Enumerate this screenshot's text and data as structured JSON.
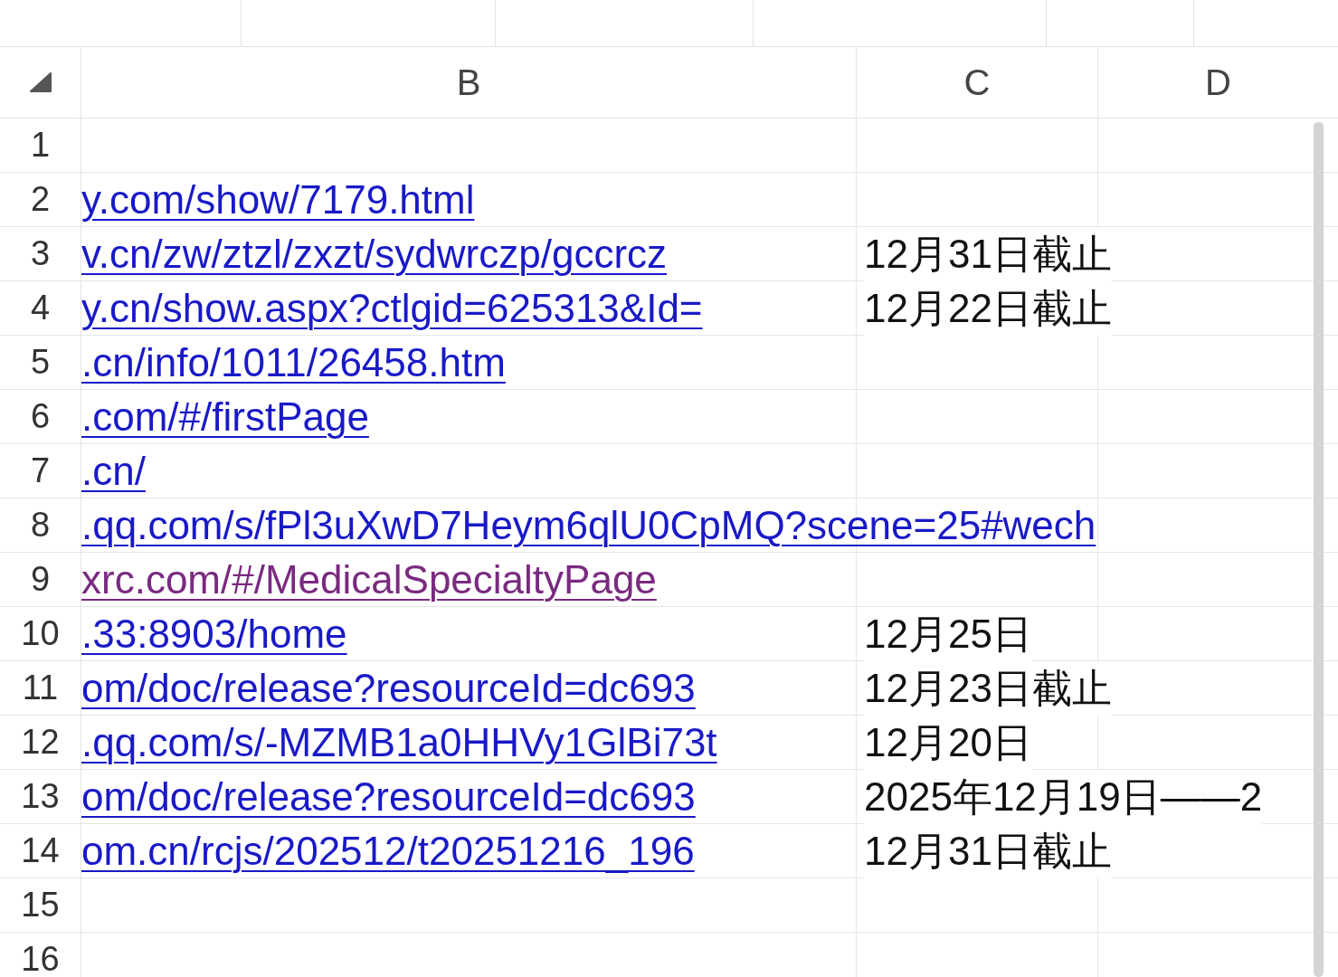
{
  "columns": [
    "B",
    "C",
    "D"
  ],
  "rows": [
    {
      "number": "1"
    },
    {
      "number": "2",
      "link": "y.com/show/7179.html",
      "visited": false
    },
    {
      "number": "3",
      "link": "v.cn/zw/ztzl/zxzt/sydwrczp/gccrcz",
      "visited": false,
      "column_c": "12月31日截止"
    },
    {
      "number": "4",
      "link": "y.cn/show.aspx?ctlgid=625313&Id=",
      "visited": false,
      "column_c": "12月22日截止"
    },
    {
      "number": "5",
      "link": ".cn/info/1011/26458.htm",
      "visited": false
    },
    {
      "number": "6",
      "link": ".com/#/firstPage",
      "visited": false
    },
    {
      "number": "7",
      "link": ".cn/",
      "visited": false
    },
    {
      "number": "8",
      "link": ".qq.com/s/fPl3uXwD7Heym6qlU0CpMQ?scene=25#wech",
      "visited": false
    },
    {
      "number": "9",
      "link": "xrc.com/#/MedicalSpecialtyPage",
      "visited": true
    },
    {
      "number": "10",
      "link": ".33:8903/home",
      "visited": false,
      "column_c": "12月25日"
    },
    {
      "number": "11",
      "link": "om/doc/release?resourceId=dc693",
      "visited": false,
      "column_c": "12月23日截止"
    },
    {
      "number": "12",
      "link": ".qq.com/s/-MZMB1a0HHVy1GlBi73t",
      "visited": false,
      "column_c": "12月20日"
    },
    {
      "number": "13",
      "link": "om/doc/release?resourceId=dc693",
      "visited": false,
      "column_c": "2025年12月19日——2"
    },
    {
      "number": "14",
      "link": "om.cn/rcjs/202512/t20251216_196",
      "visited": false,
      "column_c": "12月31日截止"
    },
    {
      "number": "15"
    },
    {
      "number": "16"
    }
  ]
}
